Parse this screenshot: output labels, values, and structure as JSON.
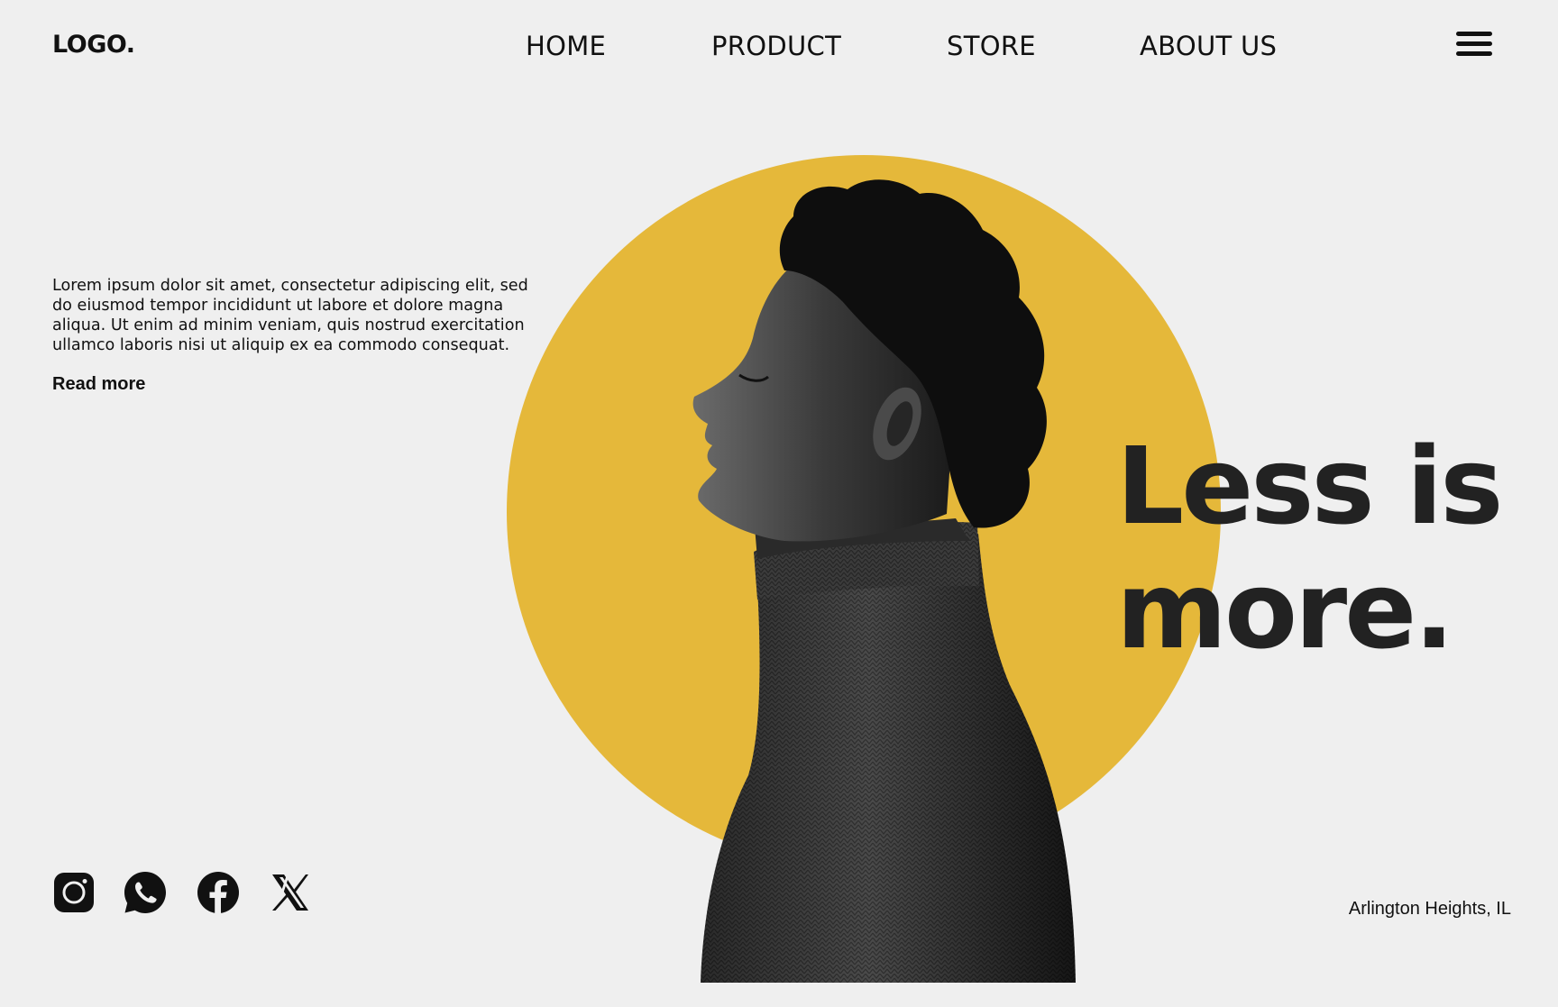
{
  "header": {
    "logo": "LOGO.",
    "nav": [
      {
        "label": "HOME"
      },
      {
        "label": "PRODUCT"
      },
      {
        "label": "STORE"
      },
      {
        "label": "ABOUT US"
      }
    ],
    "menu_icon": "hamburger-menu-icon"
  },
  "hero": {
    "intro_text": "Lorem ipsum dolor sit amet, consectetur adipiscing elit, sed do eiusmod tempor incididunt ut labore et dolore magna aliqua. Ut enim ad minim veniam, quis nostrud exercitation ullamco laboris nisi ut aliquip ex ea commodo consequat.",
    "read_more": "Read more",
    "headline_line1": "Less is",
    "headline_line2": "more.",
    "accent_color": "#e5b83a",
    "image": "profile portrait of a person in a dark turtleneck, eyes closed"
  },
  "social": [
    {
      "icon": "instagram-icon"
    },
    {
      "icon": "whatsapp-icon"
    },
    {
      "icon": "facebook-icon"
    },
    {
      "icon": "x-icon"
    }
  ],
  "footer": {
    "location": "Arlington Heights, IL"
  }
}
